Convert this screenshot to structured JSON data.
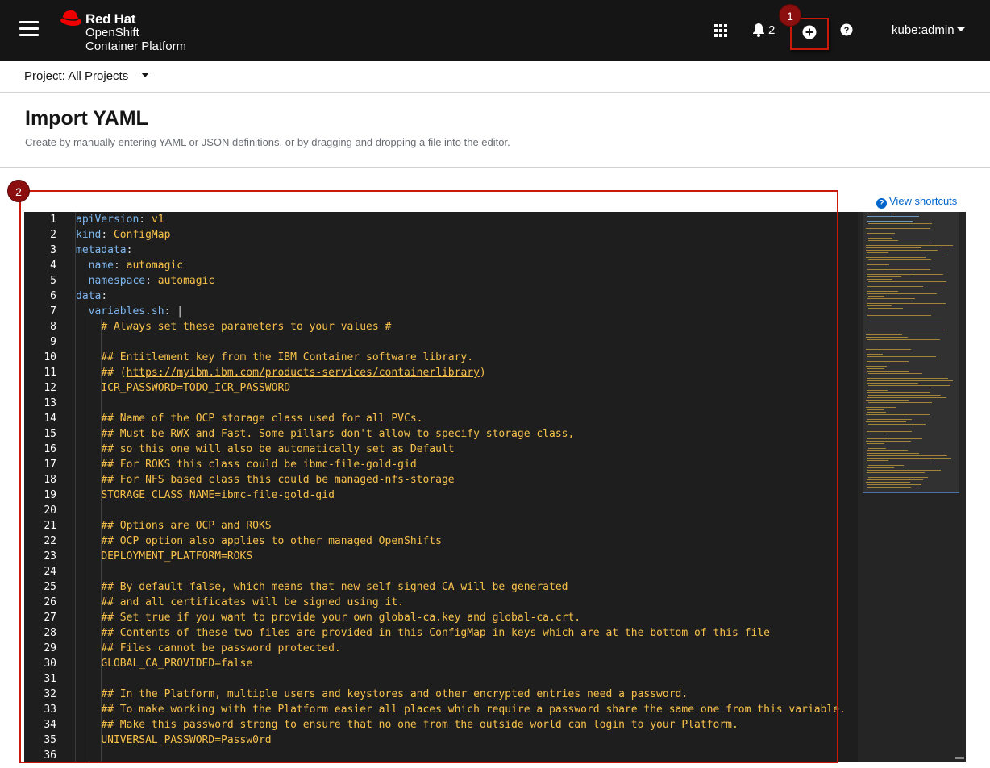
{
  "masthead": {
    "brand_line1": "Red Hat",
    "brand_line2": "OpenShift",
    "brand_line3": "Container Platform",
    "notification_count": "2",
    "user": "kube:admin",
    "icons": [
      "menu-icon",
      "red-hat-logo",
      "app-launcher-icon",
      "bell-icon",
      "plus-circle-icon",
      "help-icon",
      "caret-down-icon"
    ]
  },
  "badges": {
    "one": "1",
    "two": "2"
  },
  "project": {
    "label": "Project: All Projects"
  },
  "page": {
    "title": "Import YAML",
    "description": "Create by manually entering YAML or JSON definitions, or by dragging and dropping a file into the editor.",
    "shortcuts": "View shortcuts"
  },
  "colors": {
    "accent_red": "#c9190b",
    "badge": "#8b0f0f",
    "link": "#0066cc",
    "editor_bg": "#1e1e1e",
    "key": "#7fb8f0",
    "value": "#f7c04a"
  },
  "editor": {
    "lines": [
      {
        "n": "1",
        "indent": "",
        "key": "apiVersion",
        "val": "v1"
      },
      {
        "n": "2",
        "indent": "",
        "key": "kind",
        "val": "ConfigMap"
      },
      {
        "n": "3",
        "indent": "",
        "key": "metadata",
        "val": ""
      },
      {
        "n": "4",
        "indent": "  ",
        "key": "name",
        "val": "automagic"
      },
      {
        "n": "5",
        "indent": "  ",
        "key": "namespace",
        "val": "automagic"
      },
      {
        "n": "6",
        "indent": "",
        "key": "data",
        "val": ""
      },
      {
        "n": "7",
        "indent": "  ",
        "key": "variables.sh",
        "val": "|"
      },
      {
        "n": "8",
        "indent": "    ",
        "text": "# Always set these parameters to your values #"
      },
      {
        "n": "9",
        "indent": "",
        "text": ""
      },
      {
        "n": "10",
        "indent": "    ",
        "text": "## Entitlement key from the IBM Container software library."
      },
      {
        "n": "11",
        "indent": "    ",
        "text": "## (",
        "link": "https://myibm.ibm.com/products-services/containerlibrary",
        "after": ")"
      },
      {
        "n": "12",
        "indent": "    ",
        "text": "ICR_PASSWORD=TODO_ICR_PASSWORD"
      },
      {
        "n": "13",
        "indent": "",
        "text": ""
      },
      {
        "n": "14",
        "indent": "    ",
        "text": "## Name of the OCP storage class used for all PVCs."
      },
      {
        "n": "15",
        "indent": "    ",
        "text": "## Must be RWX and Fast. Some pillars don't allow to specify storage class,"
      },
      {
        "n": "16",
        "indent": "    ",
        "text": "## so this one will also be automatically set as Default"
      },
      {
        "n": "17",
        "indent": "    ",
        "text": "## For ROKS this class could be ibmc-file-gold-gid"
      },
      {
        "n": "18",
        "indent": "    ",
        "text": "## For NFS based class this could be managed-nfs-storage"
      },
      {
        "n": "19",
        "indent": "    ",
        "text": "STORAGE_CLASS_NAME=ibmc-file-gold-gid"
      },
      {
        "n": "20",
        "indent": "",
        "text": ""
      },
      {
        "n": "21",
        "indent": "    ",
        "text": "## Options are OCP and ROKS"
      },
      {
        "n": "22",
        "indent": "    ",
        "text": "## OCP option also applies to other managed OpenShifts"
      },
      {
        "n": "23",
        "indent": "    ",
        "text": "DEPLOYMENT_PLATFORM=ROKS"
      },
      {
        "n": "24",
        "indent": "",
        "text": ""
      },
      {
        "n": "25",
        "indent": "    ",
        "text": "## By default false, which means that new self signed CA will be generated"
      },
      {
        "n": "26",
        "indent": "    ",
        "text": "## and all certificates will be signed using it."
      },
      {
        "n": "27",
        "indent": "    ",
        "text": "## Set true if you want to provide your own global-ca.key and global-ca.crt."
      },
      {
        "n": "28",
        "indent": "    ",
        "text": "## Contents of these two files are provided in this ConfigMap in keys which are at the bottom of this file"
      },
      {
        "n": "29",
        "indent": "    ",
        "text": "## Files cannot be password protected."
      },
      {
        "n": "30",
        "indent": "    ",
        "text": "GLOBAL_CA_PROVIDED=false"
      },
      {
        "n": "31",
        "indent": "",
        "text": ""
      },
      {
        "n": "32",
        "indent": "    ",
        "text": "## In the Platform, multiple users and keystores and other encrypted entries need a password."
      },
      {
        "n": "33",
        "indent": "    ",
        "text": "## To make working with the Platform easier all places which require a password share the same one from this variable."
      },
      {
        "n": "34",
        "indent": "    ",
        "text": "## Make this password strong to ensure that no one from the outside world can login to your Platform."
      },
      {
        "n": "35",
        "indent": "    ",
        "text": "UNIVERSAL_PASSWORD=Passw0rd"
      },
      {
        "n": "36",
        "indent": "",
        "text": ""
      }
    ]
  }
}
